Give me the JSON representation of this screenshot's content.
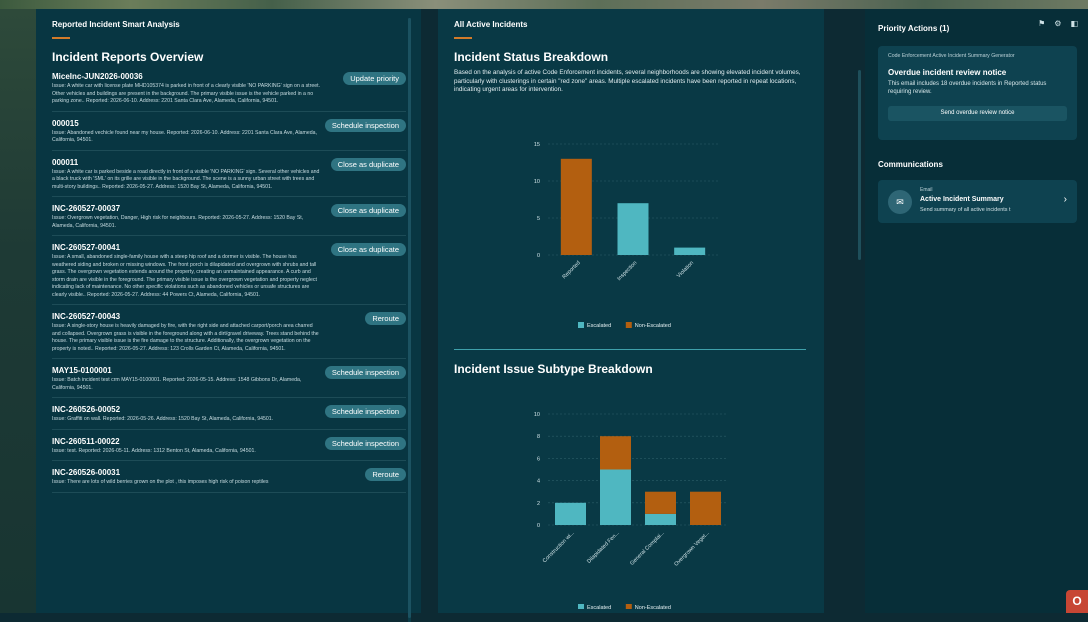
{
  "left_panel": {
    "header": "Reported Incident Smart Analysis",
    "title": "Incident Reports Overview",
    "reports": [
      {
        "id": "MiceInc-JUN2026-00036",
        "action": "Update priority",
        "description": "Issue: A white car with license plate MHD105374 is parked in front of a clearly visible 'NO PARKING' sign on a street. Other vehicles and buildings are present in the background. The primary visible issue is the vehicle parked in a no parking zone.. Reported: 2026-06-10. Address: 2201 Santa Clara Ave, Alameda, California, 94501."
      },
      {
        "id": "000015",
        "action": "Schedule inspection",
        "description": "Issue: Abandoned vechicle found near my house. Reported: 2026-06-10. Address: 2201 Santa Clara Ave, Alameda, California, 94501."
      },
      {
        "id": "000011",
        "action": "Close as duplicate",
        "description": "Issue: A white car is parked beside a road directly in front of a visible 'NO PARKING' sign. Several other vehicles and a black truck with 'SML' on its grille are visible in the background. The scene is a sunny urban street with trees and multi-story buildings.. Reported: 2026-05-27. Address: 1520 Bay St, Alameda, California, 94501."
      },
      {
        "id": "INC-260527-00037",
        "action": "Close as duplicate",
        "description": "Issue: Overgrown vegetation, Danger, High risk for neighbours. Reported: 2026-05-27. Address: 1520 Bay St, Alameda, California, 94501."
      },
      {
        "id": "INC-260527-00041",
        "action": "Close as duplicate",
        "description": "Issue: A small, abandoned single-family house with a steep hip roof and a dormer is visible. The house has weathered siding and broken or missing windows. The front porch is dilapidated and overgrown with shrubs and tall grass. The overgrown vegetation extends around the property, creating an unmaintained appearance. A curb and storm drain are visible in the foreground. The primary visible issue is the overgrown vegetation and property neglect indicating lack of maintenance. No other specific violations such as abandoned vehicles or unsafe structures are clearly visible.. Reported: 2026-05-27. Address: 44 Powers Ct, Alameda, California, 94501."
      },
      {
        "id": "INC-260527-00043",
        "action": "Reroute",
        "description": "Issue: A single-story house is heavily damaged by fire, with the right side and attached carport/porch area charred and collapsed. Overgrown grass is visible in the foreground along with a dirt/gravel driveway. Trees stand behind the house. The primary visible issue is the fire damage to the structure. Additionally, the overgrown vegetation on the property is noted.. Reported: 2026-05-27. Address: 123 Crolls Garden Ct, Alameda, California, 94501."
      },
      {
        "id": "MAY15-0100001",
        "action": "Schedule inspection",
        "description": "Issue: Batch incident test crm MAY15-0100001. Reported: 2026-05-15. Address: 1548 Gibbons Dr, Alameda, California, 94501."
      },
      {
        "id": "INC-260526-00052",
        "action": "Schedule inspection",
        "description": "Issue: Graffiti on wall. Reported: 2026-05-26. Address: 1520 Bay St, Alameda, California, 94501."
      },
      {
        "id": "INC-260511-00022",
        "action": "Schedule inspection",
        "description": "Issue: test. Reported: 2026-05-11. Address: 1312 Benton St, Alameda, California, 94501."
      },
      {
        "id": "INC-260526-00031",
        "action": "Reroute",
        "description": "Issue: There are lots of wild berries grown on the plot , this imposes high risk of poison reptiles"
      }
    ]
  },
  "mid_panel": {
    "header": "All Active Incidents",
    "status_title": "Incident Status Breakdown",
    "status_summary": "Based on the analysis of active Code Enforcement incidents, several neighborhoods are showing elevated incident volumes, particularly with clusterings in certain \"red zone\" areas. Multiple escalated incidents have been reported in repeat locations, indicating urgent areas for intervention.",
    "subtype_title": "Incident Issue Subtype Breakdown"
  },
  "chart_data": [
    {
      "type": "bar",
      "title": "Incident Status Breakdown",
      "categories": [
        "Reported",
        "Inspection",
        "Violation"
      ],
      "series": [
        {
          "name": "Escalated",
          "values": [
            0,
            7,
            1
          ],
          "color": "#4fb7c1"
        },
        {
          "name": "Non-Escalated",
          "values": [
            13,
            0,
            0
          ],
          "color": "#b35f10"
        }
      ],
      "stacked": true,
      "ylim": [
        0,
        15
      ],
      "yticks": [
        0,
        5,
        10,
        15
      ],
      "legend": "bottom"
    },
    {
      "type": "bar",
      "title": "Incident Issue Subtype Breakdown",
      "categories": [
        "Construction wi...",
        "Dilapidated Fen...",
        "General Complai...",
        "Overgrown Veget..."
      ],
      "series": [
        {
          "name": "Escalated",
          "values": [
            2,
            5,
            1,
            0
          ],
          "color": "#4fb7c1"
        },
        {
          "name": "Non-Escalated",
          "values": [
            0,
            3,
            2,
            3
          ],
          "color": "#b35f10"
        }
      ],
      "stacked": true,
      "ylim": [
        0,
        10
      ],
      "yticks": [
        0,
        2,
        4,
        6,
        8,
        10
      ],
      "legend": "bottom"
    }
  ],
  "right_panel": {
    "title": "Priority Actions (1)",
    "icons": [
      "bell-icon",
      "gear-icon",
      "panel-toggle-icon"
    ],
    "action_card": {
      "subtitle": "Code Enforcement Active Incident Summary Generator",
      "heading": "Overdue incident review notice",
      "body": "This email includes 18 overdue incidents in Reported status requiring review.",
      "button": "Send overdue review notice"
    },
    "communications_title": "Communications",
    "communication": {
      "type": "Email",
      "name": "Active Incident Summary",
      "description": "Send summary of all active incidents t"
    }
  },
  "colors": {
    "escalated": "#4fb7c1",
    "non_escalated": "#b35f10",
    "accent": "#d27b2a"
  }
}
